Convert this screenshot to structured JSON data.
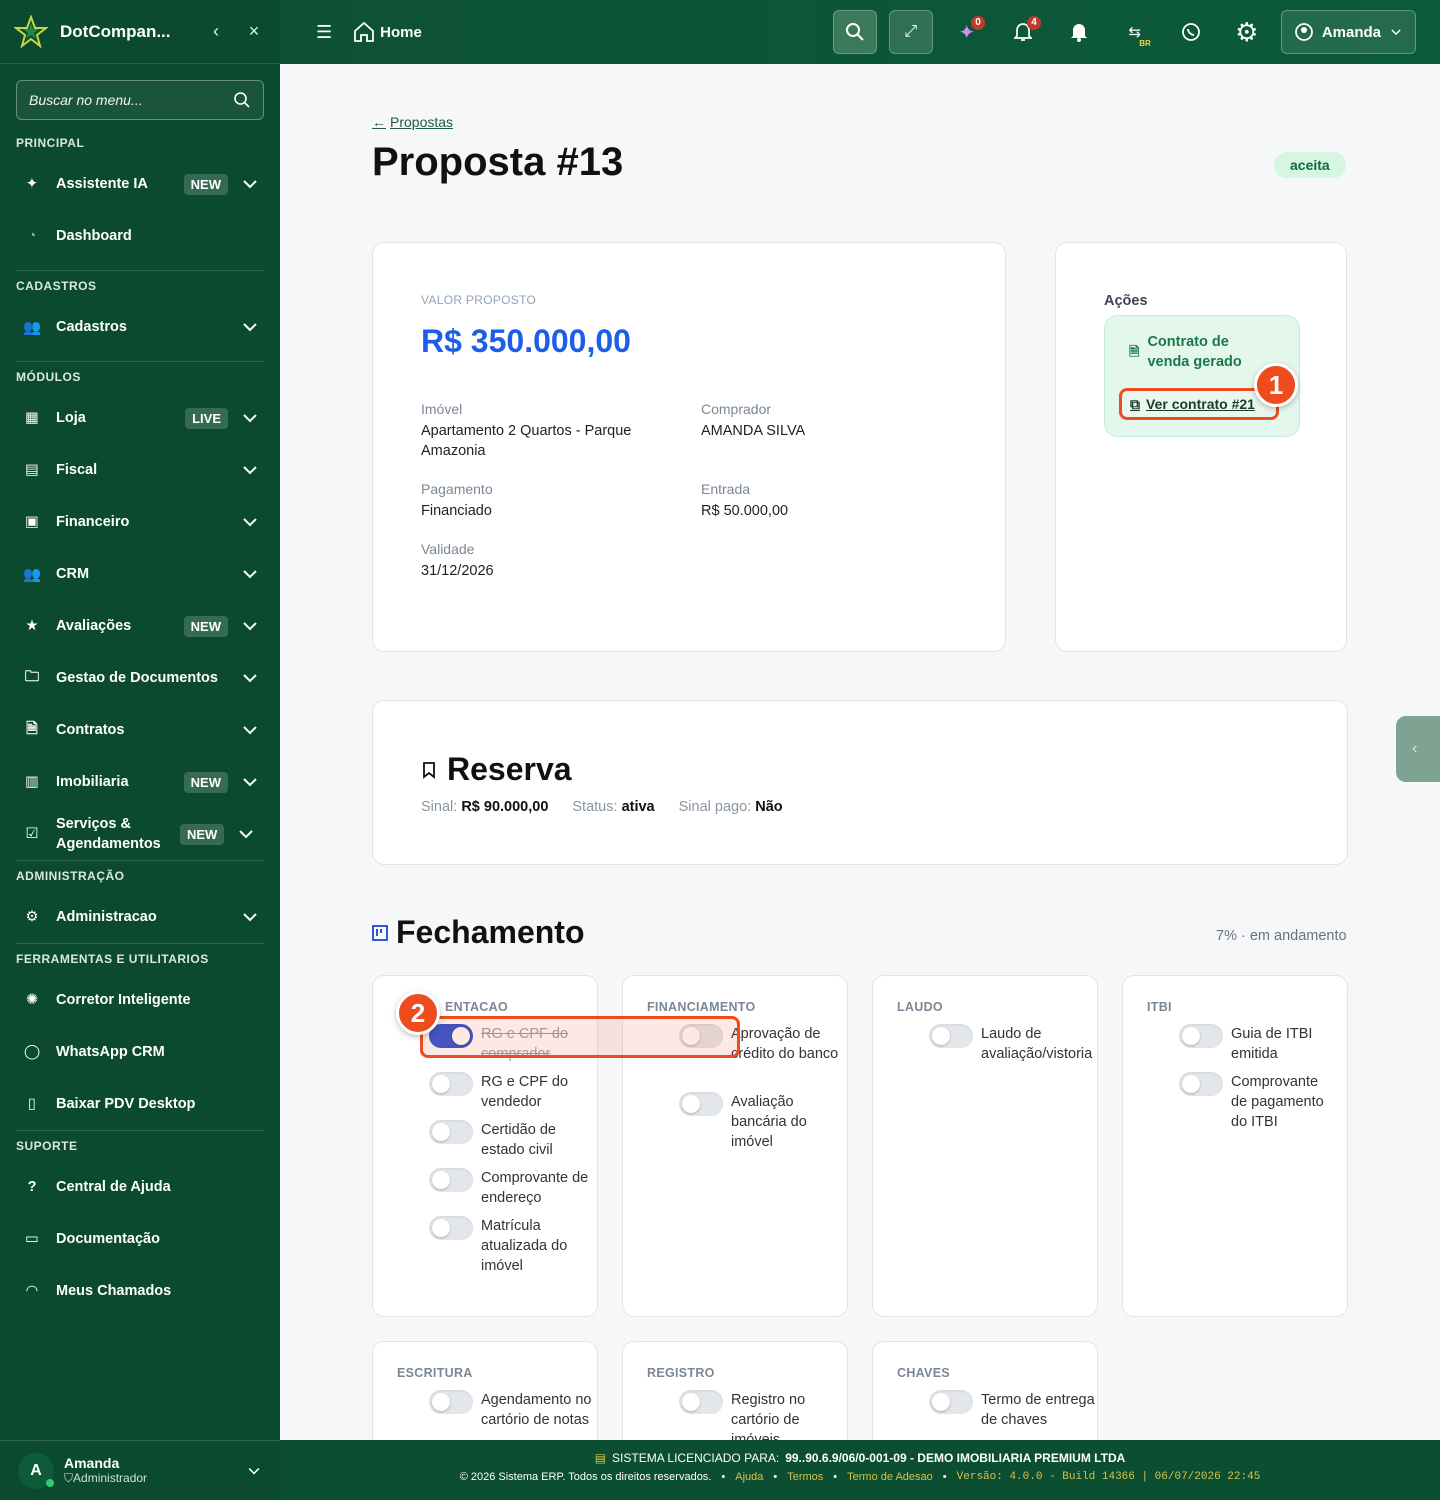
{
  "sidebar": {
    "brand": "DotCompan...",
    "search_placeholder": "Buscar no menu...",
    "sections": {
      "principal": "PRINCIPAL",
      "cadastros": "CADASTROS",
      "modulos": "MÓDULOS",
      "administracao": "ADMINISTRAÇÃO",
      "ferramentas": "FERRAMENTAS E UTILITARIOS",
      "suporte": "SUPORTE"
    },
    "items": {
      "assistente": "Assistente IA",
      "dashboard": "Dashboard",
      "cadastros": "Cadastros",
      "loja": "Loja",
      "fiscal": "Fiscal",
      "financeiro": "Financeiro",
      "crm": "CRM",
      "avaliacoes": "Avaliações",
      "documentos": "Gestao de Documentos",
      "contratos": "Contratos",
      "imobiliaria": "Imobiliaria",
      "servicos": "Serviços & Agendamentos",
      "administracao": "Administracao",
      "corretor": "Corretor Inteligente",
      "whatsapp": "WhatsApp CRM",
      "pdv": "Baixar PDV Desktop",
      "ajuda": "Central de Ajuda",
      "documentacao": "Documentação",
      "chamados": "Meus Chamados"
    },
    "badges": {
      "new": "NEW",
      "live": "LIVE"
    },
    "user": {
      "initial": "A",
      "name": "Amanda",
      "role": "Administrador"
    }
  },
  "topbar": {
    "home": "Home",
    "ai_count": "0",
    "notif_count": "4",
    "lang": "BR",
    "user": "Amanda"
  },
  "page": {
    "back": "Propostas",
    "title": "Proposta #13",
    "status": "aceita",
    "valor_label": "VALOR PROPOSTO",
    "valor": "R$ 350.000,00",
    "fields": {
      "imovel_k": "Imóvel",
      "imovel_v": "Apartamento 2 Quartos - Parque Amazonia",
      "comprador_k": "Comprador",
      "comprador_v": "AMANDA SILVA",
      "pagamento_k": "Pagamento",
      "pagamento_v": "Financiado",
      "entrada_k": "Entrada",
      "entrada_v": "R$ 50.000,00",
      "validade_k": "Validade",
      "validade_v": "31/12/2026"
    },
    "acoes": {
      "title": "Ações",
      "generated": "Contrato de venda gerado",
      "link": "Ver contrato #21"
    },
    "markers": {
      "m1": "1",
      "m2": "2"
    },
    "reserva": {
      "title": "Reserva",
      "sinal_k": "Sinal:",
      "sinal_v": "R$ 90.000,00",
      "status_k": "Status:",
      "status_v": "ativa",
      "pago_k": "Sinal pago:",
      "pago_v": "Não"
    },
    "fechamento": {
      "title": "Fechamento",
      "progress": "7% · em andamento"
    },
    "stages": {
      "documentacao": {
        "title": "ENTACAO",
        "items": [
          "RG e CPF do comprador",
          "RG e CPF do vendedor",
          "Certidão de estado civil",
          "Comprovante de endereço",
          "Matrícula atualizada do imóvel"
        ]
      },
      "financiamento": {
        "title": "FINANCIAMENTO",
        "items": [
          "Aprovação de crédito do banco",
          "Avaliação bancária do imóvel"
        ]
      },
      "laudo": {
        "title": "LAUDO",
        "items": [
          "Laudo de avaliação/vistoria"
        ]
      },
      "itbi": {
        "title": "ITBI",
        "items": [
          "Guia de ITBI emitida",
          "Comprovante de pagamento do ITBI"
        ]
      },
      "escritura": {
        "title": "ESCRITURA",
        "items": [
          "Agendamento no cartório de notas"
        ]
      },
      "registro": {
        "title": "REGISTRO",
        "items": [
          "Registro no cartório de imóveis"
        ]
      },
      "chaves": {
        "title": "CHAVES",
        "items": [
          "Termo de entrega de chaves"
        ]
      }
    }
  },
  "footer": {
    "license_label": "SISTEMA LICENCIADO PARA:",
    "license_value": "99..90.6.9/06/0-001-09 - DEMO IMOBILIARIA PREMIUM LTDA",
    "copyright": "© 2026 Sistema ERP. Todos os direitos reservados.",
    "ajuda": "Ajuda",
    "termos": "Termos",
    "adesao": "Termo de Adesao",
    "versao": "Versão: 4.0.0 - Build 14366 | 06/07/2026 22:45"
  },
  "colors": {
    "sidebar": "#0b4a2f",
    "accent_blue": "#1d5ee8",
    "highlight": "#ef4b1f",
    "status_bg": "#d6f5e3"
  }
}
